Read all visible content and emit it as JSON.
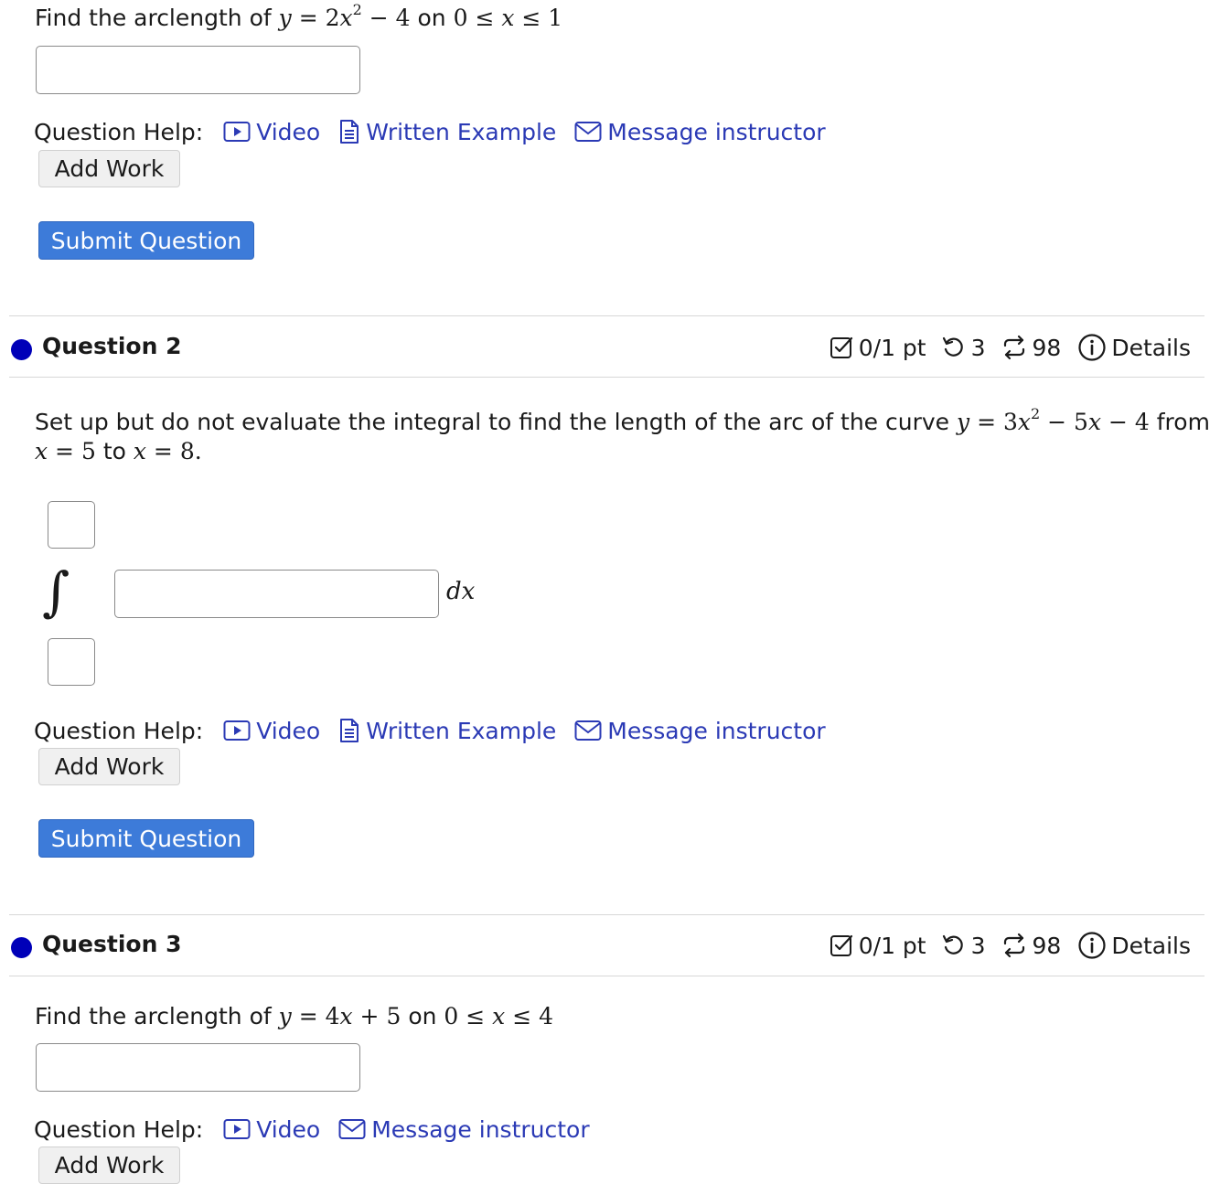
{
  "q1": {
    "prompt_text": "Find the arclength of",
    "prompt_math": "y = 2x² − 4",
    "prompt_on": "on",
    "prompt_range": "0 ≤ x ≤ 1",
    "answer_value": ""
  },
  "help": {
    "label": "Question Help:",
    "video": "Video",
    "written_example": "Written Example",
    "message": "Message instructor"
  },
  "buttons": {
    "add_work": "Add Work",
    "submit": "Submit Question"
  },
  "q2": {
    "title": "Question 2",
    "score": "0/1 pt",
    "retries": "3",
    "attempts": "98",
    "details": "Details",
    "prompt_line1_text": "Set up but do not evaluate the integral to find the length of the arc of the curve",
    "prompt_line1_math": "y = 3x² − 5x − 4",
    "prompt_line1_from": "from",
    "prompt_line2_a": "x = 5",
    "prompt_line2_to": "to",
    "prompt_line2_b": "x = 8.",
    "integral_symbol": "∫",
    "dx": "dx"
  },
  "q3": {
    "title": "Question 3",
    "score": "0/1 pt",
    "retries": "3",
    "attempts": "98",
    "details": "Details",
    "prompt_text": "Find the arclength of",
    "prompt_math": "y = 4x + 5",
    "prompt_on": "on",
    "prompt_range": "0 ≤ x ≤ 4",
    "answer_value": ""
  },
  "colors": {
    "link": "#2b3ab5",
    "submit_bg": "#3d7bd9",
    "status_dot": "#0000b8"
  },
  "icons": [
    "video-icon",
    "document-icon",
    "mail-icon",
    "checkbox-icon",
    "retry-icon",
    "attempts-icon",
    "info-icon",
    "status-dot-icon"
  ]
}
